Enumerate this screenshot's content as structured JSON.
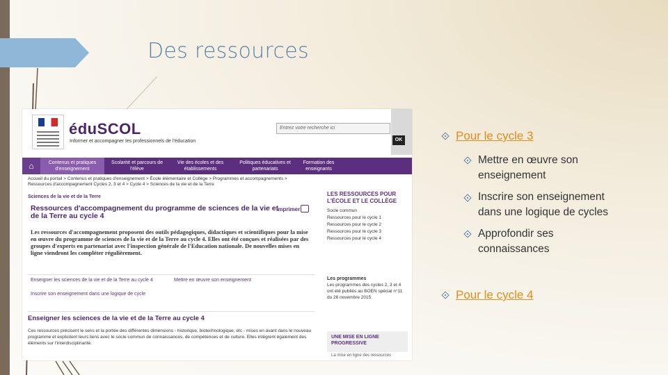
{
  "slide": {
    "title": "Des ressources",
    "bullets": [
      {
        "text": "Pour le cycle 3",
        "link": true
      },
      {
        "text": "Mettre en œuvre son enseignement"
      },
      {
        "text": "Inscrire son enseignement dans une logique de cycles"
      },
      {
        "text": "Approfondir ses connaissances"
      },
      {
        "text": "Pour le cycle 4",
        "link": true
      }
    ]
  },
  "screenshot": {
    "brand": "éduSCOL",
    "brand_sub": "Informer et accompagner les professionnels de l'éducation",
    "search_placeholder": "Entrez votre recherche ici",
    "ok": "OK",
    "nav": [
      "Contenus et pratiques d'enseignement",
      "Scolarité et parcours de l'élève",
      "Vie des écoles et des établissements",
      "Politiques éducatives et partenariats",
      "Formation des enseignants"
    ],
    "breadcrumb": "Accueil du portail > Contenus et pratiques d'enseignement > École élémentaire et Collège > Programmes et accompagnements > Ressources d'accompagnement Cycles 2, 3 et 4 > Cycle 4 > Sciences de la vie et de la Terre",
    "section": "Sciences de la vie et de la Terre",
    "h1": "Ressources d'accompagnement du programme de sciences de la vie et de la Terre au cycle 4",
    "print": "Imprimer",
    "intro": "Les ressources d'accompagnement proposent des outils pédagogiques, didactiques et scientifiques pour la mise en œuvre du programme de sciences de la vie et de la Terre au cycle 4. Elles ont été conçues et réalisées par des groupes d'experts en partenariat avec l'inspection générale de l'Education nationale. De nouvelles mises en ligne viendront les compléter régulièrement.",
    "links": [
      "Enseigner les sciences de la vie et de la Terre au cycle 4",
      "Mettre en œuvre son enseignement",
      "Inscrire son enseignement dans une logique de cycle"
    ],
    "h2": "Enseigner les sciences de la vie et de la Terre au cycle 4",
    "body": "Ces ressources précisent le sens et la portée des différentes dimensions - historique, biotechnologique, etc - mises en avant dans le nouveau programme et explicitent leurs liens avec le socle commun de connaissances, de compétences et de culture. Elles intègrent également des éléments sur l'interdisciplinarité.",
    "right_head": "LES RESSOURCES POUR L'ÉCOLE ET LE COLLÈGE",
    "right_list": [
      "Socle commun",
      "Ressources pour le cycle 1",
      "Ressources pour le cycle 2",
      "Ressources pour le cycle 3",
      "Ressources pour le cycle 4"
    ],
    "programmes_head": "Les programmes",
    "programmes_text": "Les programmes des cycles 2, 3 et 4 ont été publiés au BOEN spécial n°11 du 26 novembre 2015",
    "mise_en_ligne": "UNE MISE EN LIGNE PROGRESSIVE",
    "mise_en_ligne_sub": "La mise en ligne des ressources"
  },
  "colors": {
    "accent_title": "#5b82a6",
    "link_orange": "#e48b1a",
    "eduscol_purple": "#5b2f7e"
  }
}
